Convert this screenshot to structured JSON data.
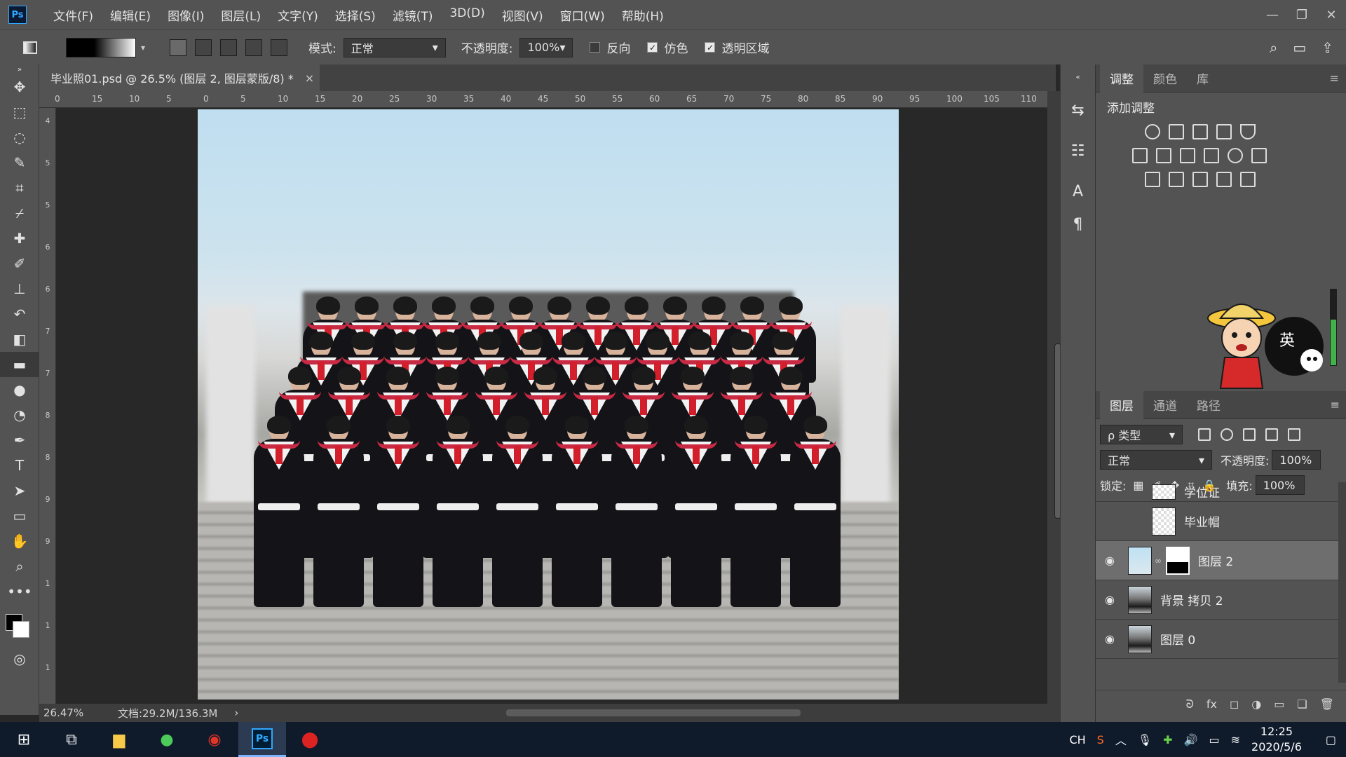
{
  "app": {
    "logo": "Ps"
  },
  "menu": [
    "文件(F)",
    "编辑(E)",
    "图像(I)",
    "图层(L)",
    "文字(Y)",
    "选择(S)",
    "滤镜(T)",
    "3D(D)",
    "视图(V)",
    "窗口(W)",
    "帮助(H)"
  ],
  "window_controls": {
    "minimize": "—",
    "restore": "❐",
    "close": "✕"
  },
  "options": {
    "mode_label": "模式:",
    "mode_value": "正常",
    "opacity_label": "不透明度:",
    "opacity_value": "100%",
    "reverse": {
      "label": "反向",
      "checked": false
    },
    "dither": {
      "label": "仿色",
      "checked": true
    },
    "transparency": {
      "label": "透明区域",
      "checked": true
    }
  },
  "document": {
    "tab_title": "毕业照01.psd @ 26.5% (图层 2, 图层蒙版/8) *",
    "tab_close": "×",
    "ruler_top": [
      "0",
      "15",
      "10",
      "5",
      "0",
      "5",
      "10",
      "15",
      "20",
      "25",
      "30",
      "35",
      "40",
      "45",
      "50",
      "55",
      "60",
      "65",
      "70",
      "75",
      "80",
      "85",
      "90",
      "95",
      "100",
      "105",
      "110"
    ],
    "ruler_left": [
      "4",
      "5",
      "5",
      "6",
      "6",
      "7",
      "7",
      "8",
      "8",
      "9",
      "9",
      "1",
      "1",
      "1"
    ]
  },
  "status": {
    "zoom": "26.47%",
    "docsize": "文档:29.2M/136.3M",
    "arrow": "›"
  },
  "adjustments": {
    "tabs": [
      "调整",
      "颜色",
      "库"
    ],
    "active_tab": "调整",
    "title": "添加调整"
  },
  "layers": {
    "tabs": [
      "图层",
      "通道",
      "路径"
    ],
    "active_tab": "图层",
    "filter_label": "ρ 类型",
    "blend_mode": "正常",
    "opacity_label": "不透明度:",
    "opacity_value": "100%",
    "lock_label": "锁定:",
    "fill_label": "填充:",
    "fill_value": "100%",
    "items": [
      {
        "name": "学位证",
        "visible": false
      },
      {
        "name": "毕业帽",
        "visible": false
      },
      {
        "name": "图层 2",
        "visible": true,
        "selected": true
      },
      {
        "name": "背景 拷贝 2",
        "visible": true
      },
      {
        "name": "图层 0",
        "visible": true
      }
    ],
    "footer": [
      "ᘐ",
      "fx",
      "◻",
      "◑",
      "▭",
      "❏",
      "🗑"
    ]
  },
  "ime": {
    "label": "英"
  },
  "taskbar": {
    "tray_lang": "CH",
    "time": "12:25",
    "date": "2020/5/6"
  }
}
